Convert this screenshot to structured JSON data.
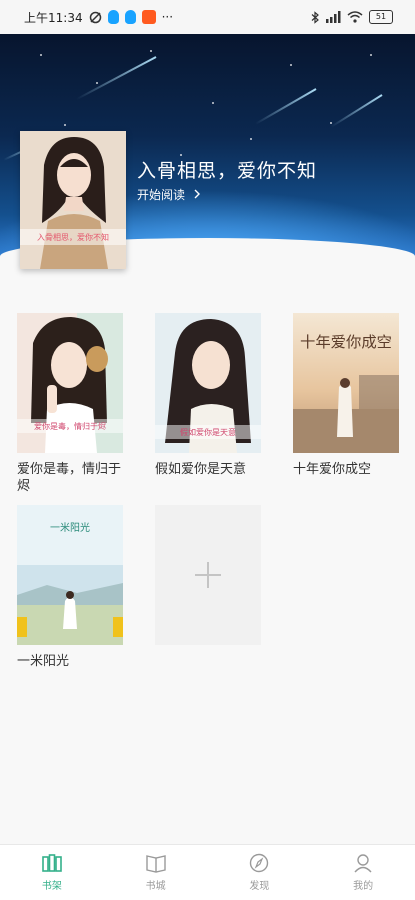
{
  "status_bar": {
    "time": "上午11:34",
    "dots": "···",
    "battery": "51"
  },
  "banner": {
    "title": "入骨相思，爱你不知",
    "action": "开始阅读",
    "cover_caption": "入骨相思，爱你不知"
  },
  "books": [
    {
      "title": "爱你是毒，情归于烬",
      "cover_caption": "爱你是毒，情归于烬"
    },
    {
      "title": "假如爱你是天意",
      "cover_caption": "假如爱你是天意"
    },
    {
      "title": "十年爱你成空",
      "cover_caption": "十年爱你成空"
    },
    {
      "title": "一米阳光",
      "cover_caption": "一米阳光"
    }
  ],
  "nav": [
    {
      "label": "书架",
      "icon": "bookshelf-icon",
      "active": true
    },
    {
      "label": "书城",
      "icon": "book-open-icon",
      "active": false
    },
    {
      "label": "发现",
      "icon": "compass-icon",
      "active": false
    },
    {
      "label": "我的",
      "icon": "user-icon",
      "active": false
    }
  ],
  "colors": {
    "accent": "#34b08a",
    "inactive": "#9a9a9a",
    "banner_dark": "#07152e",
    "banner_light": "#2d7ad0"
  }
}
